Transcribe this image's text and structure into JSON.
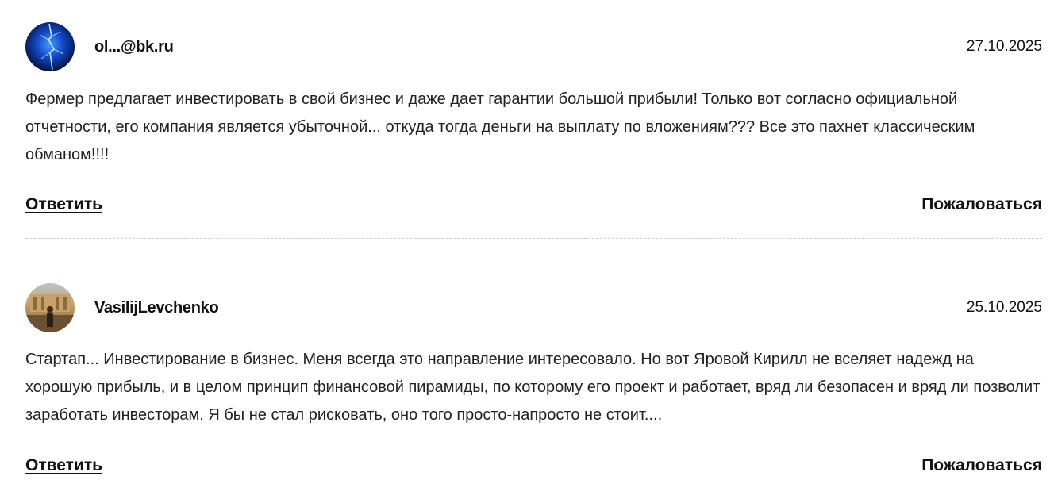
{
  "comments": [
    {
      "author": "ol...@bk.ru",
      "date": "27.10.2025",
      "text": "Фермер предлагает инвестировать в свой бизнес и даже дает гарантии большой прибыли! Только вот согласно официальной отчетности, его компания является убыточной... откуда тогда деньги на выплату по вложениям??? Все это пахнет классическим обманом!!!!",
      "reply_label": "Ответить",
      "report_label": "Пожаловаться",
      "avatar_icon": "lightning-avatar-icon"
    },
    {
      "author": "VasilijLevchenko",
      "date": "25.10.2025",
      "text": "Стартап... Инвестирование в бизнес. Меня всегда это направление интересовало. Но вот Яровой Кирилл не вселяет надежд на хорошую прибыль, и в целом принцип финансовой пирамиды, по которому его проект и работает, вряд ли безопасен и вряд ли позволит заработать инвесторам. Я бы не стал рисковать, оно того просто-напросто не стоит....",
      "reply_label": "Ответить",
      "report_label": "Пожаловаться",
      "avatar_icon": "person-photo-avatar-icon"
    }
  ],
  "colors": {
    "text": "#222222",
    "divider": "#cfcfcf",
    "background": "#ffffff"
  }
}
